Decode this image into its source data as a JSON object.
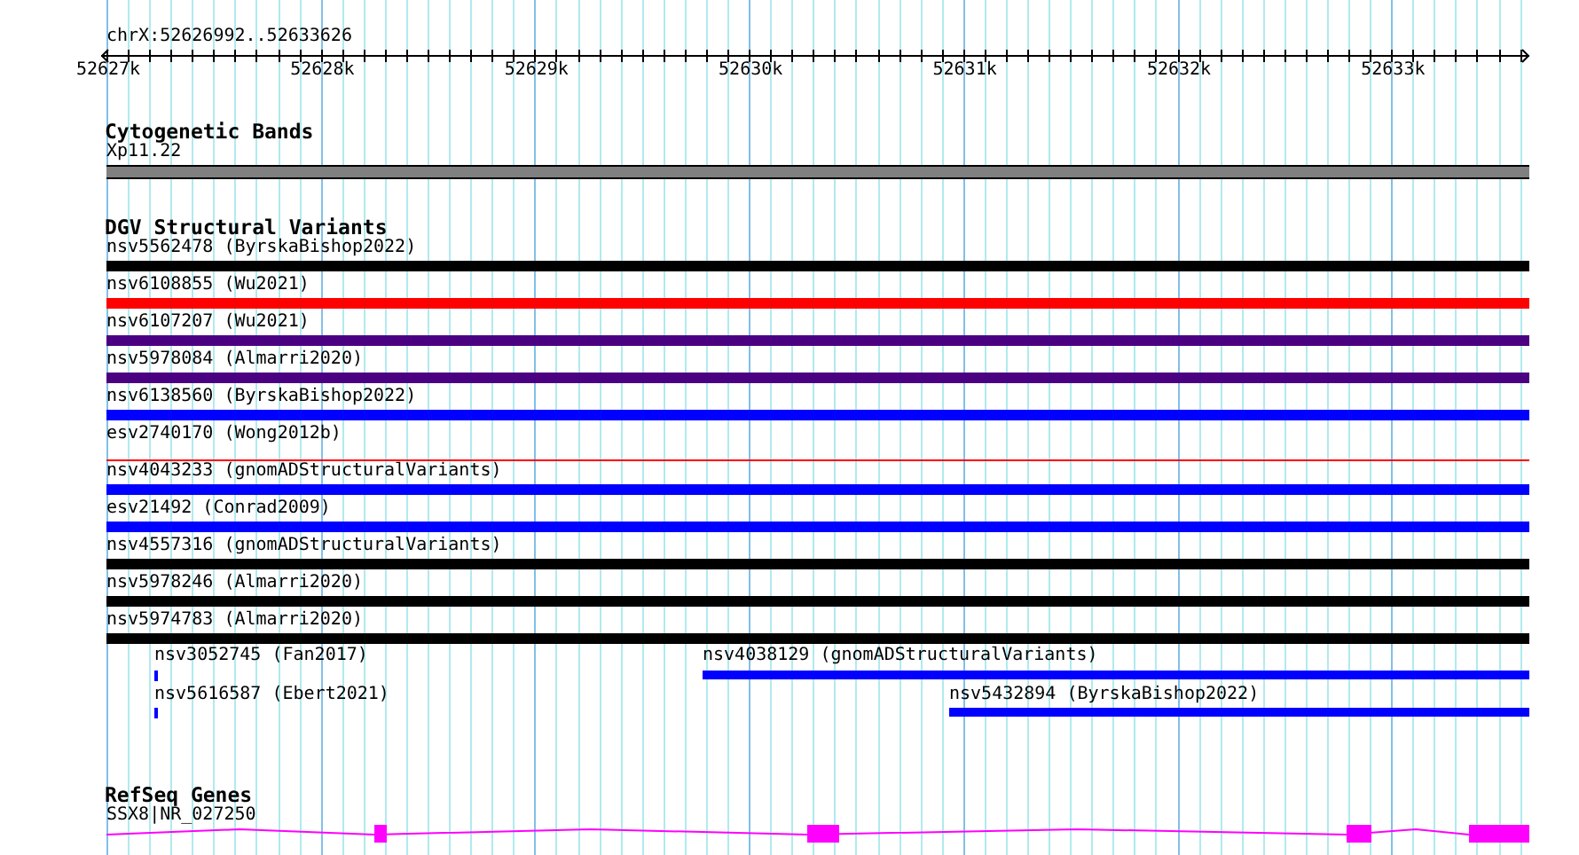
{
  "location": "chrX:52626992..52633626",
  "ruler_labels": [
    "52627k",
    "52628k",
    "52629k",
    "52630k",
    "52631k",
    "52632k",
    "52633k"
  ],
  "tracks": [
    {
      "kind": "bands",
      "title": "Cytogenetic Bands",
      "features": [
        {
          "label": "Xp11.22",
          "kind": "band",
          "color": "#808080"
        }
      ]
    },
    {
      "kind": "variants",
      "title": "DGV Structural Variants",
      "features": [
        {
          "label": "nsv5562478 (ByrskaBishop2022)",
          "kind": "bar",
          "color": "#000000"
        },
        {
          "label": "nsv6108855 (Wu2021)",
          "kind": "bar",
          "color": "#ff0000"
        },
        {
          "label": "nsv6107207 (Wu2021)",
          "kind": "bar",
          "color": "#4b0082"
        },
        {
          "label": "nsv5978084 (Almarri2020)",
          "kind": "bar",
          "color": "#4b0082"
        },
        {
          "label": "nsv6138560 (ByrskaBishop2022)",
          "kind": "bar",
          "color": "#0000ff"
        },
        {
          "label": "esv2740170 (Wong2012b)",
          "kind": "line",
          "color": "#ff0000"
        },
        {
          "label": "nsv4043233 (gnomADStructuralVariants)",
          "kind": "bar",
          "color": "#0000ff"
        },
        {
          "label": "esv21492 (Conrad2009)",
          "kind": "bar",
          "color": "#0000ff"
        },
        {
          "label": "nsv4557316 (gnomADStructuralVariants)",
          "kind": "bar",
          "color": "#000000"
        },
        {
          "label": "nsv5978246 (Almarri2020)",
          "kind": "bar",
          "color": "#000000"
        },
        {
          "label": "nsv5974783 (Almarri2020)",
          "kind": "bar",
          "color": "#000000"
        },
        {
          "label": "nsv3052745 (Fan2017)",
          "kind": "bar",
          "color": "#0000ff"
        },
        {
          "label": "nsv4038129 (gnomADStructuralVariants)",
          "kind": "bar",
          "color": "#0000ff"
        },
        {
          "label": "nsv5616587 (Ebert2021)",
          "kind": "bar",
          "color": "#0000ff"
        },
        {
          "label": "nsv5432894 (ByrskaBishop2022)",
          "kind": "bar",
          "color": "#0000ff"
        }
      ]
    },
    {
      "kind": "genes",
      "title": "RefSeq Genes",
      "features": [
        {
          "label": "SSX8|NR_027250",
          "kind": "gene",
          "color": "#ff00ff"
        }
      ]
    }
  ]
}
